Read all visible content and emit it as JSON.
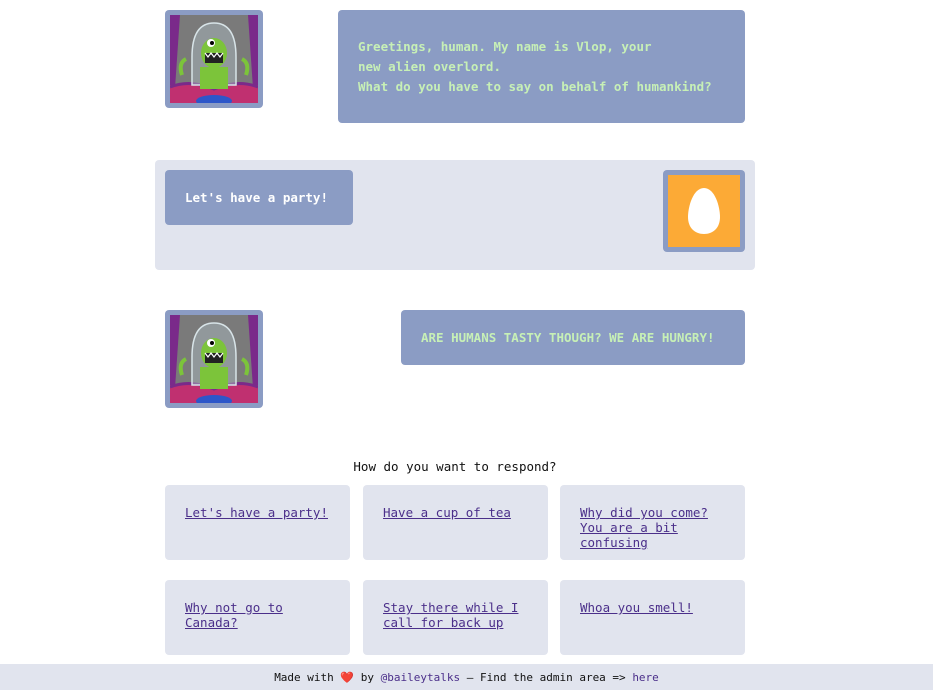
{
  "conversation": {
    "alien_message_1": {
      "lines": [
        "Greetings, human. My name is Vlop, your",
        "new alien overlord.",
        "What do you have to say on behalf of humankind?"
      ]
    },
    "player_message": "Let's have a party!",
    "alien_message_2": "ARE HUMANS TASTY THOUGH? WE ARE HUNGRY!"
  },
  "respond": {
    "prompt": "How do you want to respond?",
    "choices": [
      "Let's have a party!",
      "Have a cup of tea",
      "Why did you come? You are a bit confusing",
      "Why not go to Canada?",
      "Stay there while I call for back up",
      "Whoa you smell!"
    ]
  },
  "footer": {
    "made_with": "Made with",
    "heart": "❤️",
    "by": "by",
    "author_link": "@baileytalks",
    "middle": "— Find the admin area =>",
    "admin_link": "here"
  },
  "colors": {
    "bubble": "#8b9cc4",
    "panel": "#e1e4ee",
    "alien_text": "#c7f0b6",
    "link": "#4b2f8a",
    "egg_bg": "#fcaa36"
  },
  "icons": {
    "alien_avatar": "alien-avatar-icon",
    "user_avatar": "egg-avatar-icon"
  }
}
